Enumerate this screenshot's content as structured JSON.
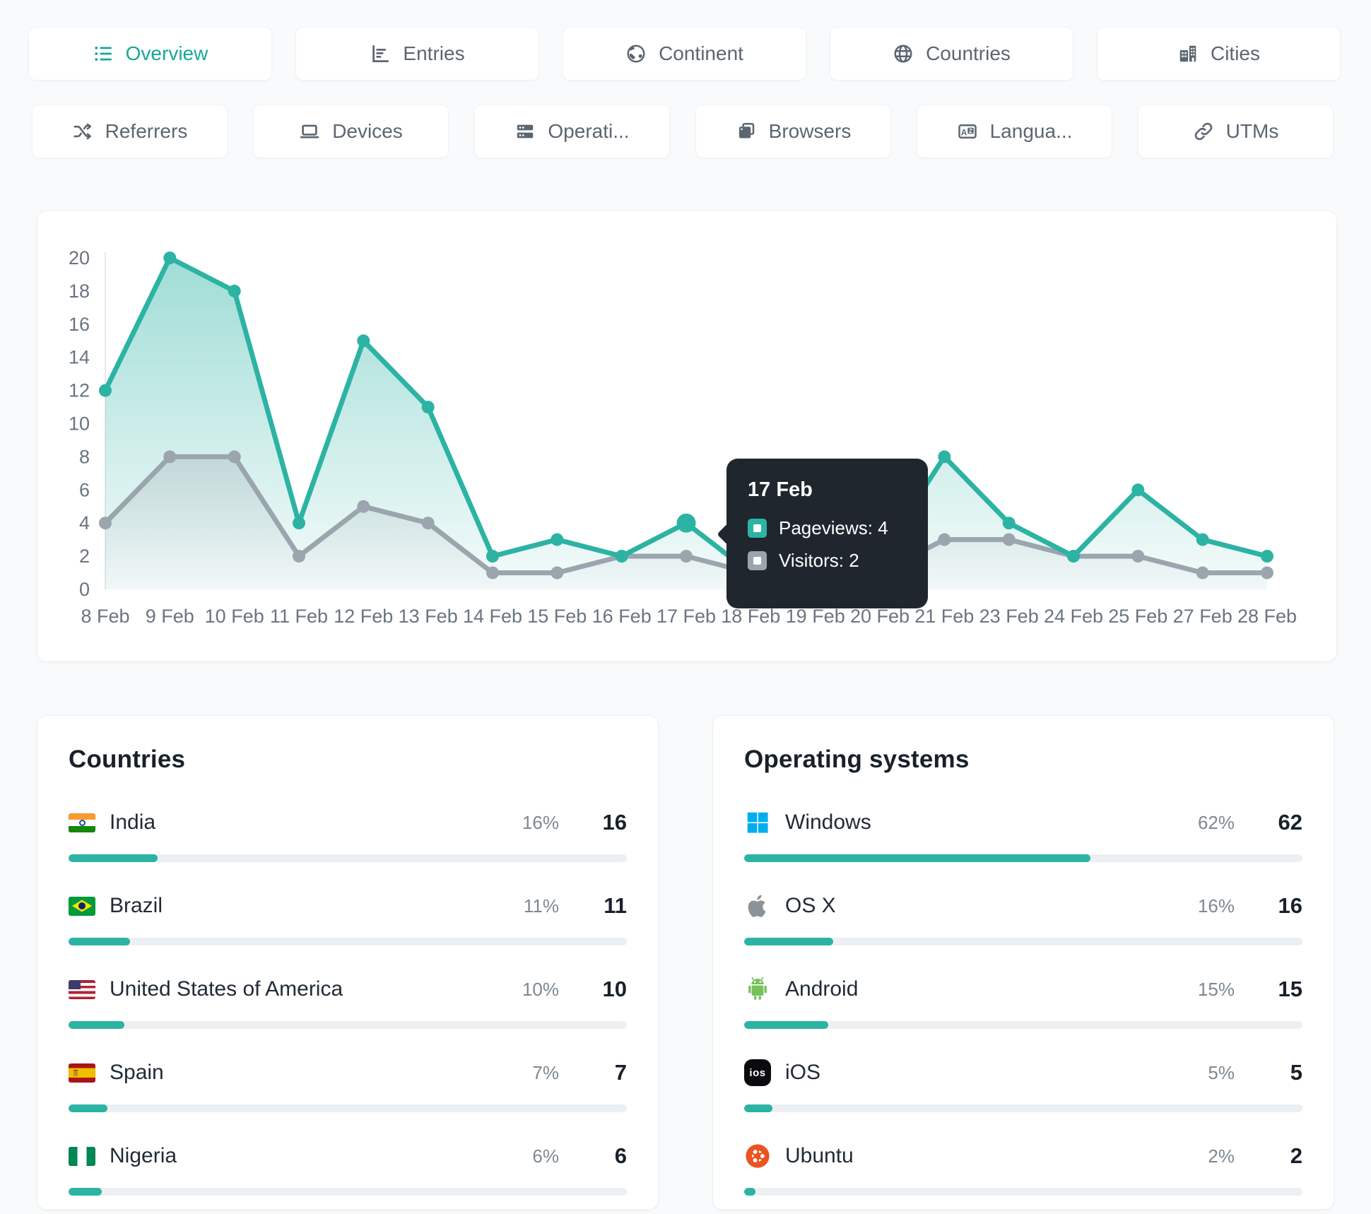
{
  "colors": {
    "accent": "#2cb3a4",
    "gray_series": "#9aa5ad",
    "tooltip_bg": "#20262e",
    "bar_track": "#edf0f2",
    "windows_blue": "#00adef",
    "android_green": "#77c159",
    "ubuntu_orange": "#e95420"
  },
  "tabs_row1": [
    {
      "id": "overview",
      "label": "Overview",
      "icon": "list-icon",
      "active": true
    },
    {
      "id": "entries",
      "label": "Entries",
      "icon": "bar-chart-icon",
      "active": false
    },
    {
      "id": "continent",
      "label": "Continent",
      "icon": "earth-icon",
      "active": false
    },
    {
      "id": "countries",
      "label": "Countries",
      "icon": "globe-icon",
      "active": false
    },
    {
      "id": "cities",
      "label": "Cities",
      "icon": "buildings-icon",
      "active": false
    }
  ],
  "tabs_row2": [
    {
      "id": "referrers",
      "label": "Referrers",
      "icon": "shuffle-icon",
      "active": false
    },
    {
      "id": "devices",
      "label": "Devices",
      "icon": "laptop-icon",
      "active": false
    },
    {
      "id": "operating-systems",
      "label": "Operati...",
      "icon": "server-icon",
      "active": false
    },
    {
      "id": "browsers",
      "label": "Browsers",
      "icon": "browser-icon",
      "active": false
    },
    {
      "id": "languages",
      "label": "Langua...",
      "icon": "language-icon",
      "active": false
    },
    {
      "id": "utms",
      "label": "UTMs",
      "icon": "link-icon",
      "active": false
    }
  ],
  "chart_data": {
    "type": "line",
    "x": [
      "8 Feb",
      "9 Feb",
      "10 Feb",
      "11 Feb",
      "12 Feb",
      "13 Feb",
      "14 Feb",
      "15 Feb",
      "16 Feb",
      "17 Feb",
      "18 Feb",
      "19 Feb",
      "20 Feb",
      "21 Feb",
      "23 Feb",
      "24 Feb",
      "25 Feb",
      "27 Feb",
      "28 Feb"
    ],
    "series": [
      {
        "name": "Pageviews",
        "color": "#2cb3a4",
        "values": [
          12,
          20,
          18,
          4,
          15,
          11,
          2,
          3,
          2,
          4,
          1,
          1,
          2,
          8,
          4,
          2,
          6,
          3,
          2
        ]
      },
      {
        "name": "Visitors",
        "color": "#9aa5ad",
        "values": [
          4,
          8,
          8,
          2,
          5,
          4,
          1,
          1,
          2,
          2,
          1,
          1,
          1,
          3,
          3,
          2,
          2,
          1,
          1
        ]
      }
    ],
    "ylim": [
      0,
      20
    ],
    "yticks": [
      0,
      2,
      4,
      6,
      8,
      10,
      12,
      14,
      16,
      18,
      20
    ],
    "grid": false,
    "legend": "none",
    "area_fill": true,
    "tooltip": {
      "date": "17 Feb",
      "x_index": 9,
      "rows": [
        {
          "name": "Pageviews",
          "value": 4,
          "color": "#2cb3a4"
        },
        {
          "name": "Visitors",
          "value": 2,
          "color": "#9aa5ad"
        }
      ]
    },
    "highlight": {
      "series": "Pageviews",
      "x_index": 9
    }
  },
  "panels": [
    {
      "title": "Countries",
      "rows": [
        {
          "label": "India",
          "icon": "flag-india",
          "pct": 16,
          "pct_label": "16%",
          "value": "16"
        },
        {
          "label": "Brazil",
          "icon": "flag-brazil",
          "pct": 11,
          "pct_label": "11%",
          "value": "11"
        },
        {
          "label": "United States of America",
          "icon": "flag-usa",
          "pct": 10,
          "pct_label": "10%",
          "value": "10"
        },
        {
          "label": "Spain",
          "icon": "flag-spain",
          "pct": 7,
          "pct_label": "7%",
          "value": "7"
        },
        {
          "label": "Nigeria",
          "icon": "flag-nigeria",
          "pct": 6,
          "pct_label": "6%",
          "value": "6"
        }
      ]
    },
    {
      "title": "Operating systems",
      "rows": [
        {
          "label": "Windows",
          "icon": "windows-icon",
          "pct": 62,
          "pct_label": "62%",
          "value": "62"
        },
        {
          "label": "OS X",
          "icon": "apple-icon",
          "pct": 16,
          "pct_label": "16%",
          "value": "16"
        },
        {
          "label": "Android",
          "icon": "android-icon",
          "pct": 15,
          "pct_label": "15%",
          "value": "15"
        },
        {
          "label": "iOS",
          "icon": "ios-icon",
          "pct": 5,
          "pct_label": "5%",
          "value": "5"
        },
        {
          "label": "Ubuntu",
          "icon": "ubuntu-icon",
          "pct": 2,
          "pct_label": "2%",
          "value": "2"
        }
      ]
    }
  ]
}
